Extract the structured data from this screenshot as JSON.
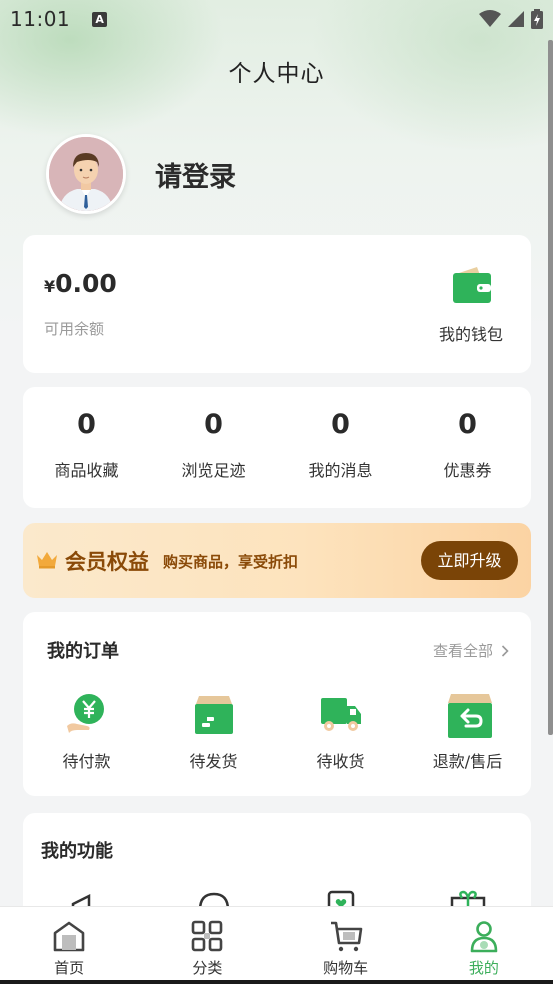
{
  "status_bar": {
    "time": "11:01",
    "app_icon_letter": "A"
  },
  "header": {
    "title": "个人中心"
  },
  "profile": {
    "login_label": "请登录"
  },
  "wallet": {
    "currency_symbol": "¥",
    "balance": "0.00",
    "balance_label": "可用余额",
    "wallet_label": "我的钱包"
  },
  "stats": [
    {
      "value": "0",
      "label": "商品收藏"
    },
    {
      "value": "0",
      "label": "浏览足迹"
    },
    {
      "value": "0",
      "label": "我的消息"
    },
    {
      "value": "0",
      "label": "优惠券"
    }
  ],
  "vip": {
    "title": "会员权益",
    "subtitle": "购买商品，享受折扣",
    "button": "立即升级"
  },
  "orders": {
    "title": "我的订单",
    "view_all": "查看全部",
    "items": [
      {
        "label": "待付款",
        "icon": "payment-icon"
      },
      {
        "label": "待发货",
        "icon": "package-icon"
      },
      {
        "label": "待收货",
        "icon": "truck-icon"
      },
      {
        "label": "退款/售后",
        "icon": "refund-icon"
      }
    ]
  },
  "functions": {
    "title": "我的功能"
  },
  "tab_bar": {
    "items": [
      {
        "label": "首页",
        "icon": "home-icon"
      },
      {
        "label": "分类",
        "icon": "category-icon"
      },
      {
        "label": "购物车",
        "icon": "cart-icon"
      },
      {
        "label": "我的",
        "icon": "user-icon"
      }
    ],
    "active_index": 3
  },
  "colors": {
    "accent_green": "#3cae5b",
    "icon_green": "#2fb35a",
    "vip_brown": "#7a4407",
    "vip_text": "#8a4a08"
  }
}
